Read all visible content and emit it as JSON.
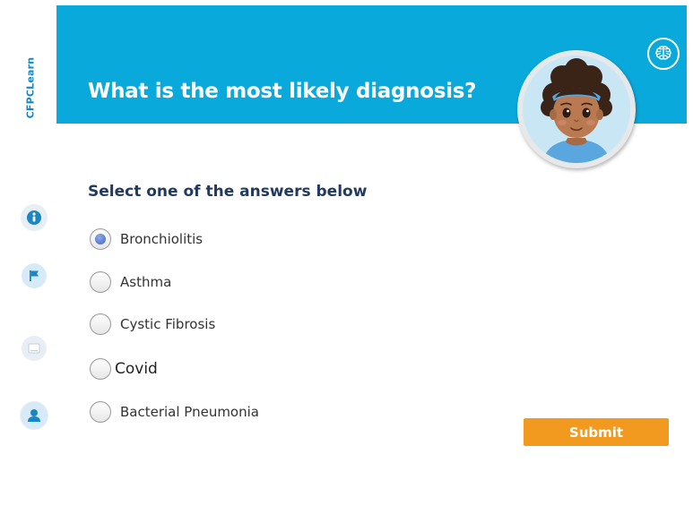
{
  "brand": {
    "logo_text": "CFPCLearn"
  },
  "header": {
    "title": "What is the most likely diagnosis?"
  },
  "question": {
    "instruction": "Select one of the answers below",
    "options": [
      {
        "label": "Bronchiolitis",
        "selected": true
      },
      {
        "label": "Asthma",
        "selected": false
      },
      {
        "label": "Cystic Fibrosis",
        "selected": false
      },
      {
        "label": "Covid",
        "selected": false
      },
      {
        "label": "Bacterial Pneumonia",
        "selected": false
      }
    ]
  },
  "actions": {
    "submit_label": "Submit"
  },
  "sidebar": {
    "icons": [
      "info-icon",
      "flag-icon",
      "notes-icon",
      "profile-icon"
    ]
  },
  "colors": {
    "header": "#0aa9dc",
    "title_text": "#ffffff",
    "instruction_text": "#223a5e",
    "submit": "#f29a1f",
    "radio_selected": "#3f62c7",
    "sidebar_icon": "#1a86c4"
  }
}
